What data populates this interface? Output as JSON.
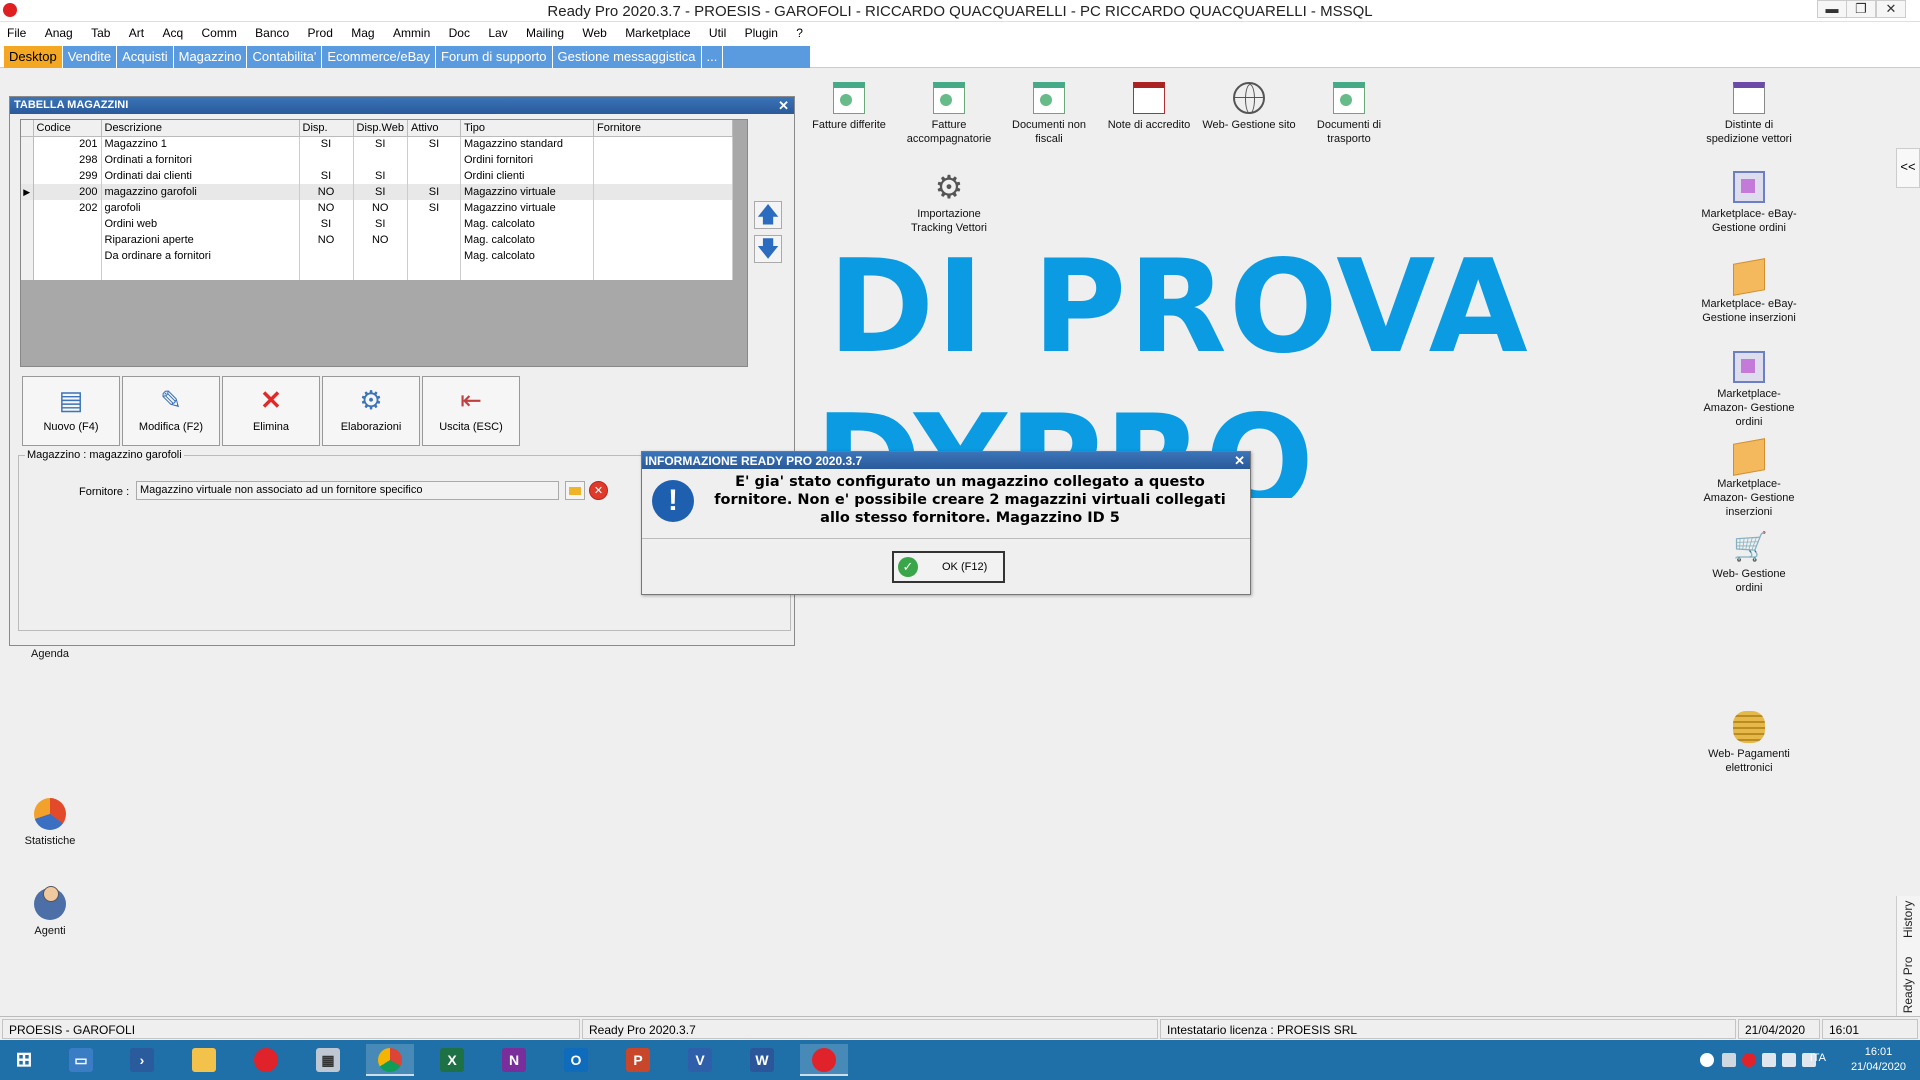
{
  "window": {
    "title": "Ready Pro 2020.3.7 - PROESIS - GAROFOLI - RICCARDO QUACQUARELLI - PC RICCARDO QUACQUARELLI - MSSQL",
    "min_glyph": "▬",
    "max_glyph": "❐",
    "close_glyph": "✕"
  },
  "menu": [
    "File",
    "Anag",
    "Tab",
    "Art",
    "Acq",
    "Comm",
    "Banco",
    "Prod",
    "Mag",
    "Ammin",
    "Doc",
    "Lav",
    "Mailing",
    "Web",
    "Marketplace",
    "Util",
    "Plugin",
    "?"
  ],
  "tabs": [
    "Desktop",
    "Vendite",
    "Acquisti",
    "Magazzino",
    "Contabilita'",
    "Ecommerce/eBay",
    "Forum di supporto",
    "Gestione messaggistica",
    "..."
  ],
  "desktop_icons": {
    "fatture_differite": "Fatture differite",
    "fatture_accompagnatorie": "Fatture accompagnatorie",
    "documenti_non_fiscali": "Documenti non fiscali",
    "note_accredito": "Note di accredito",
    "web_gestione_sito": "Web- Gestione sito",
    "documenti_trasporto": "Documenti di trasporto",
    "importazione_tracking": "Importazione Tracking Vettori",
    "distinte_spedizione": "Distinte di spedizione vettori",
    "ebay_ordini": "Marketplace- eBay- Gestione ordini",
    "ebay_inserzioni": "Marketplace- eBay- Gestione inserzioni",
    "amazon_ordini": "Marketplace- Amazon- Gestione ordini",
    "amazon_inserzioni": "Marketplace- Amazon- Gestione inserzioni",
    "web_gestione_ordini": "Web- Gestione ordini",
    "web_pagamenti": "Web- Pagamenti elettronici",
    "agenda": "Agenda",
    "statistiche": "Statistiche",
    "agenti": "Agenti"
  },
  "watermark": {
    "line1": "DI PROVA",
    "line2": "DYPRO"
  },
  "side_panel": {
    "toggle": "<<",
    "history": "History",
    "assistente": "Assistente Ready Pro"
  },
  "tabella": {
    "title": "TABELLA MAGAZZINI",
    "columns": [
      "Codice",
      "Descrizione",
      "Disp.",
      "Disp.Web",
      "Attivo",
      "Tipo",
      "Fornitore"
    ],
    "rows": [
      [
        "201",
        "Magazzino 1",
        "SI",
        "SI",
        "SI",
        "Magazzino standard",
        ""
      ],
      [
        "298",
        "Ordinati a fornitori",
        "",
        "",
        "",
        "Ordini fornitori",
        ""
      ],
      [
        "299",
        "Ordinati dai clienti",
        "SI",
        "SI",
        "",
        "Ordini clienti",
        ""
      ],
      [
        "200",
        "magazzino garofoli",
        "NO",
        "SI",
        "SI",
        "Magazzino virtuale",
        ""
      ],
      [
        "202",
        "garofoli",
        "NO",
        "NO",
        "SI",
        "Magazzino virtuale",
        ""
      ],
      [
        "",
        "Ordini web",
        "SI",
        "SI",
        "",
        "Mag. calcolato",
        ""
      ],
      [
        "",
        "Riparazioni aperte",
        "NO",
        "NO",
        "",
        "Mag. calcolato",
        ""
      ],
      [
        "",
        "Da ordinare a fornitori",
        "",
        "",
        "",
        "Mag. calcolato",
        ""
      ]
    ],
    "current_row_index": 3,
    "current_row_marker": "▶",
    "buttons": {
      "nuovo": "Nuovo (F4)",
      "modifica": "Modifica (F2)",
      "elimina": "Elimina",
      "elaborazioni": "Elaborazioni",
      "uscita": "Uscita (ESC)"
    },
    "detail_legend": "Magazzino : magazzino garofoli",
    "fornitore_label": "Fornitore :",
    "fornitore_value": "Magazzino virtuale non associato ad un fornitore specifico"
  },
  "dialog": {
    "title": "INFORMAZIONE READY PRO 2020.3.7",
    "message": "E' gia' stato configurato un magazzino collegato a questo fornitore. Non e' possibile creare 2 magazzini virtuali collegati allo stesso fornitore. Magazzino ID 5",
    "ok_label": "OK (F12)",
    "icon_glyph": "!"
  },
  "status": {
    "company": "PROESIS - GAROFOLI",
    "version": "Ready Pro 2020.3.7",
    "license": "Intestatario licenza : PROESIS SRL",
    "date": "21/04/2020",
    "time": "16:01"
  },
  "taskbar": {
    "lang": "ITA",
    "time": "16:01",
    "date": "21/04/2020"
  },
  "colors": {
    "tab_bar": "#5a9be0",
    "tab_active": "#f4a722",
    "watermark": "#0a9be3",
    "title_bar": "#2a5a9a",
    "taskbar": "#1f6fa8"
  }
}
